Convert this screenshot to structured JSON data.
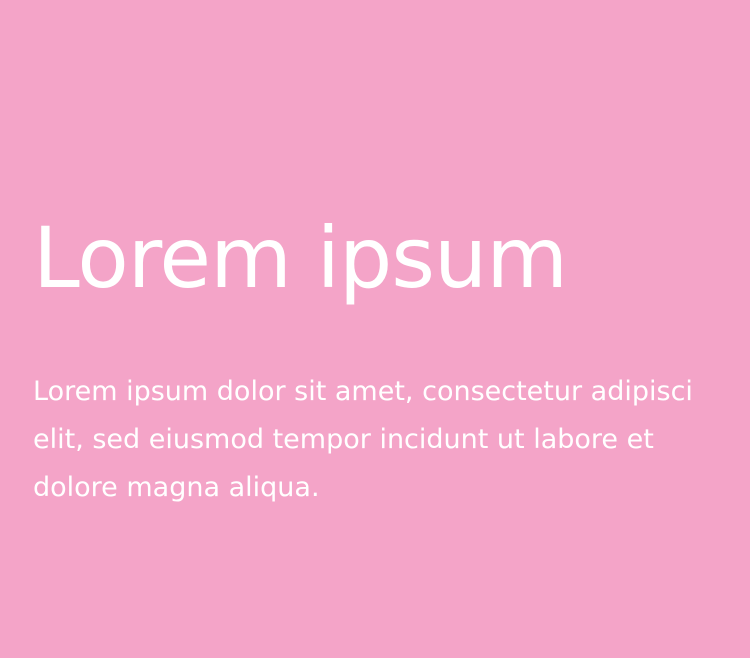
{
  "theme": {
    "background_color": "#f4a4c8",
    "text_color": "#ffffff"
  },
  "hero": {
    "title": "Lorem ipsum",
    "body": "Lorem ipsum dolor sit amet, consectetur adipisci elit, sed eiusmod tempor incidunt ut labore et dolore magna aliqua."
  }
}
